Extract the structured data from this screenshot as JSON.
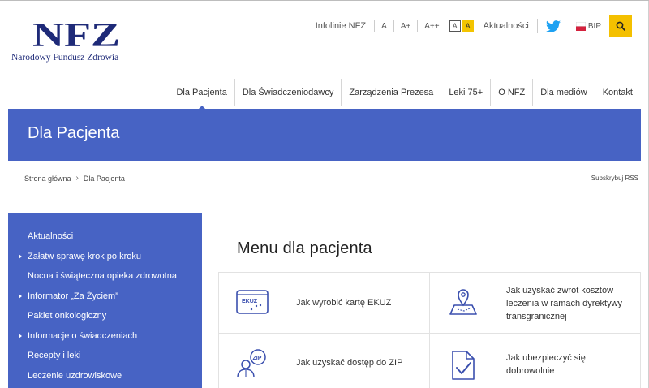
{
  "logo": {
    "mark": "NFZ",
    "text": "Narodowy Fundusz Zdrowia"
  },
  "utility": {
    "infoline": "Infolinie NFZ",
    "font_sizes": [
      "A",
      "A+",
      "A++"
    ],
    "contrast": [
      "A",
      "A"
    ],
    "news": "Aktualności",
    "bip": "BIP",
    "icons": [
      "twitter-icon",
      "bip-flag-icon",
      "search-icon"
    ],
    "search_color": "#f4c000"
  },
  "nav": {
    "items": [
      "Dla Pacjenta",
      "Dla Świadczeniodawcy",
      "Zarządzenia Prezesa",
      "Leki 75+",
      "O NFZ",
      "Dla mediów",
      "Kontakt"
    ],
    "active_index": 0
  },
  "banner": {
    "title": "Dla Pacjenta",
    "color": "#4763c4"
  },
  "breadcrumb": {
    "home": "Strona główna",
    "separator": "›",
    "current": "Dla Pacjenta",
    "rss": "Subskrybuj RSS"
  },
  "sidebar": {
    "items": [
      {
        "label": "Aktualności",
        "expandable": false
      },
      {
        "label": "Załatw sprawę krok po kroku",
        "expandable": true
      },
      {
        "label": "Nocna i świąteczna opieka zdrowotna",
        "expandable": false
      },
      {
        "label": "Informator „Za Życiem”",
        "expandable": true
      },
      {
        "label": "Pakiet onkologiczny",
        "expandable": false
      },
      {
        "label": "Informacje o świadczeniach",
        "expandable": true
      },
      {
        "label": "Recepty i leki",
        "expandable": false
      },
      {
        "label": "Leczenie uzdrowiskowe",
        "expandable": false
      }
    ]
  },
  "content": {
    "title": "Menu dla pacjenta",
    "tiles": [
      {
        "icon": "ekuz-card-icon",
        "icon_text": "EKUZ",
        "label": "Jak wyrobić kartę EKUZ"
      },
      {
        "icon": "map-pin-icon",
        "label": "Jak uzyskać zwrot kosztów leczenia w ramach dyrektywy transgranicznej"
      },
      {
        "icon": "zip-user-icon",
        "icon_text": "ZIP",
        "label": "Jak uzyskać dostęp do ZIP"
      },
      {
        "icon": "document-check-icon",
        "label": "Jak ubezpieczyć się dobrowolnie"
      }
    ]
  }
}
